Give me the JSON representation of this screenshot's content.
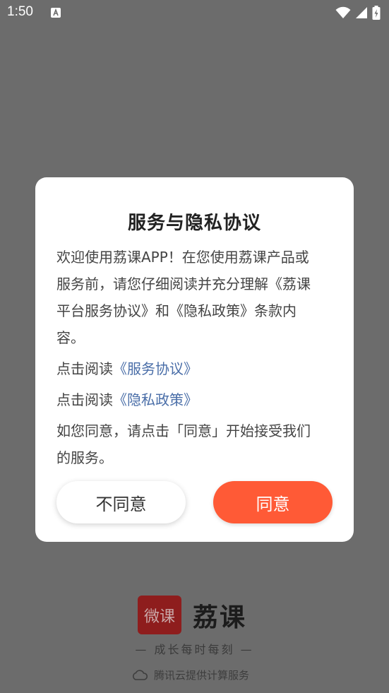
{
  "status_bar": {
    "time": "1:50",
    "notification_icon": "text-badge-icon",
    "icons": [
      "wifi-icon",
      "signal-icon",
      "battery-charging-icon"
    ]
  },
  "dialog": {
    "title": "服务与隐私协议",
    "intro_lines": [
      "欢迎使用荔课APP！在您使用荔课产品或",
      "服务前，请您仔细阅读并充分理解《荔课",
      "平台服务协议》和《隐私政策》条款内",
      "容。"
    ],
    "read_prefix": "点击阅读",
    "service_link": "《服务协议》",
    "privacy_link": "《隐私政策》",
    "consent_lines": [
      "如您同意，请点击「同意」开始接受我们",
      "的服务。"
    ],
    "decline_label": "不同意",
    "agree_label": "同意"
  },
  "brand": {
    "logo_text": "微课",
    "name": "荔课",
    "slogan": "— 成长每时每刻 —",
    "provider": "腾讯云提供计算服务",
    "provider_icon": "cloud-icon"
  },
  "colors": {
    "overlay": "#6c6c6c",
    "accent": "#ff5a36",
    "link": "#4a6ea8",
    "logo_bg": "#8e1d1d"
  }
}
